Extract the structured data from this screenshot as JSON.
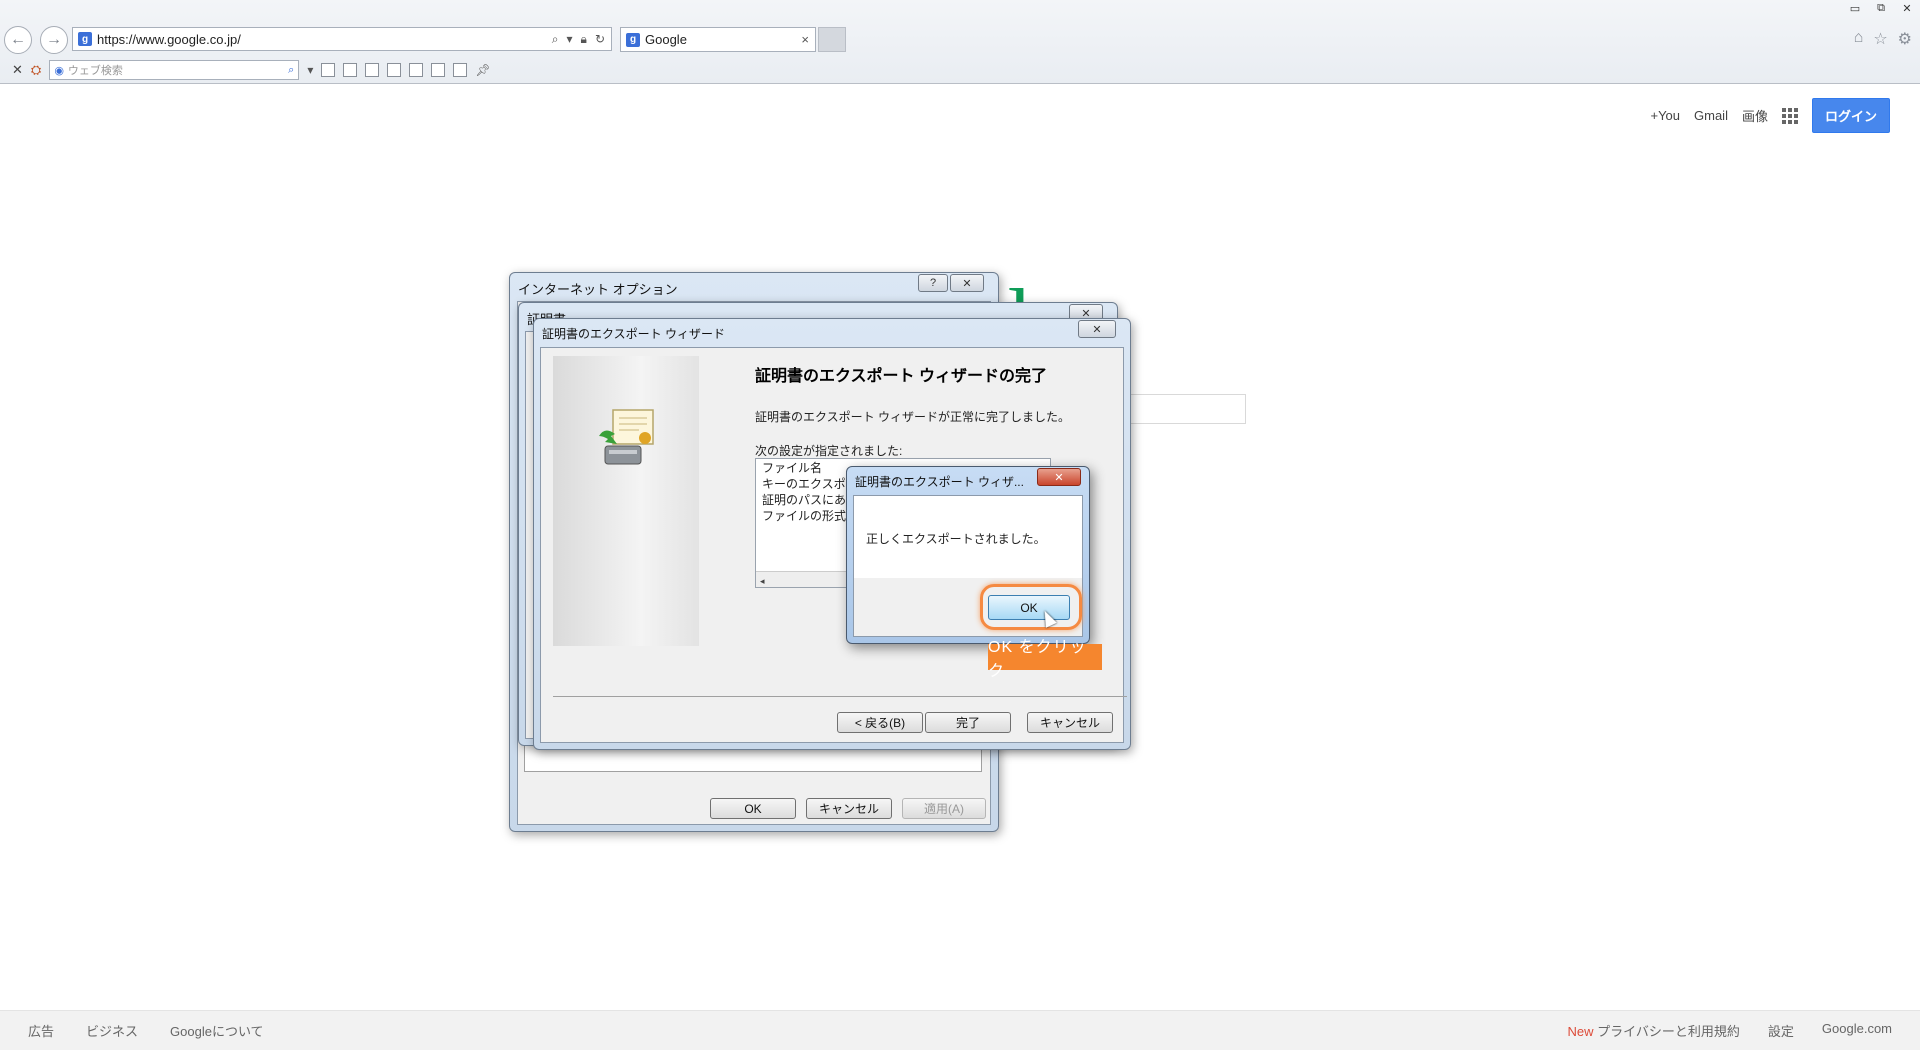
{
  "browser": {
    "url": "https://www.google.co.jp/",
    "tab_title": "Google",
    "favicon_letter": "g",
    "tab_close": "×",
    "web_search_placeholder": "ウェブ検索",
    "window_controls": [
      "▭",
      "⧉",
      "✕"
    ]
  },
  "google": {
    "header_links": [
      "+You",
      "Gmail",
      "画像"
    ],
    "login_label": "ログイン",
    "footer_left": [
      "広告",
      "ビジネス",
      "Googleについて"
    ],
    "footer_new": "New",
    "footer_privacy": "プライバシーと利用規約",
    "footer_settings": "設定",
    "footer_domain": "Google.com"
  },
  "internet_options": {
    "title": "インターネット オプション",
    "help_label": "?",
    "close_label": "✕",
    "ok_label": "OK",
    "cancel_label": "キャンセル",
    "apply_label": "適用(A)"
  },
  "certificates_dialog": {
    "title": "証明書",
    "close_label": "✕"
  },
  "export_wizard": {
    "title": "証明書のエクスポート ウィザード",
    "close_label": "✕",
    "heading": "証明書のエクスポート ウィザードの完了",
    "description": "証明書のエクスポート ウィザードが正常に完了しました。",
    "settings_label": "次の設定が指定されました:",
    "settings_items": [
      "ファイル名",
      "キーのエクスポート",
      "証明のパスにある",
      "ファイルの形式"
    ],
    "back_label": "< 戻る(B)",
    "finish_label": "完了",
    "cancel_label": "キャンセル"
  },
  "message_box": {
    "title": "証明書のエクスポート ウィザ...",
    "close_label": "✕",
    "message": "正しくエクスポートされました。",
    "ok_label": "OK"
  },
  "annotation": {
    "callout_text": "OK をクリック",
    "color": "#f5862e"
  }
}
